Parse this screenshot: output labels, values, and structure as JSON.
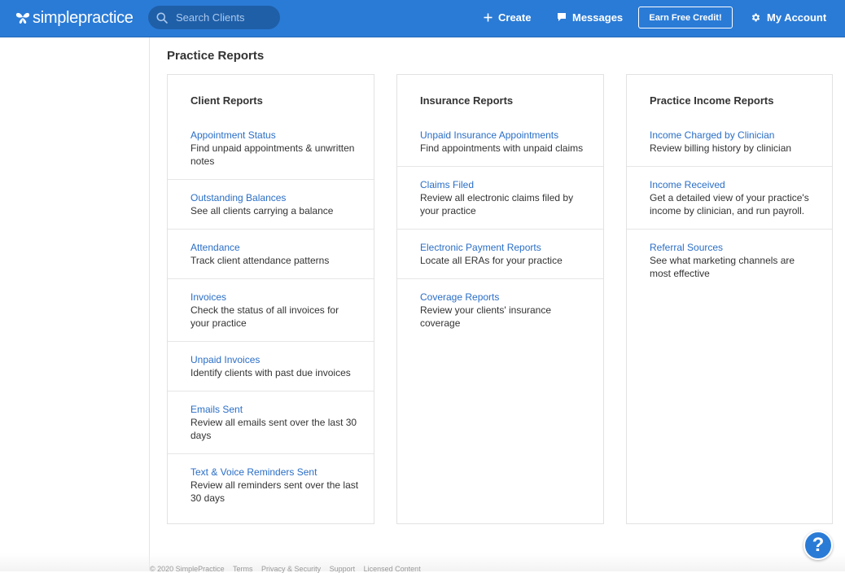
{
  "header": {
    "logo_part1": "simple",
    "logo_part2": "practice",
    "search_placeholder": "Search Clients",
    "create_label": "Create",
    "messages_label": "Messages",
    "earn_credit_label": "Earn Free Credit!",
    "account_label": "My Account",
    "brand_color": "#2a7bd6"
  },
  "page": {
    "title": "Practice Reports"
  },
  "columns": [
    {
      "title": "Client Reports",
      "reports": [
        {
          "link": "Appointment Status",
          "desc": "Find unpaid appointments & unwritten notes"
        },
        {
          "link": "Outstanding Balances",
          "desc": "See all clients carrying a balance"
        },
        {
          "link": "Attendance",
          "desc": "Track client attendance patterns"
        },
        {
          "link": "Invoices",
          "desc": "Check the status of all invoices for your practice"
        },
        {
          "link": "Unpaid Invoices",
          "desc": "Identify clients with past due invoices"
        },
        {
          "link": "Emails Sent",
          "desc": "Review all emails sent over the last 30 days"
        },
        {
          "link": "Text & Voice Reminders Sent",
          "desc": "Review all reminders sent over the last 30 days"
        }
      ]
    },
    {
      "title": "Insurance Reports",
      "reports": [
        {
          "link": "Unpaid Insurance Appointments",
          "desc": "Find appointments with unpaid claims"
        },
        {
          "link": "Claims Filed",
          "desc": "Review all electronic claims filed by your practice"
        },
        {
          "link": "Electronic Payment Reports",
          "desc": "Locate all ERAs for your practice"
        },
        {
          "link": "Coverage Reports",
          "desc": "Review your clients' insurance coverage"
        }
      ]
    },
    {
      "title": "Practice Income Reports",
      "reports": [
        {
          "link": "Income Charged by Clinician",
          "desc": "Review billing history by clinician"
        },
        {
          "link": "Income Received",
          "desc": "Get a detailed view of your practice's income by clinician, and run payroll."
        },
        {
          "link": "Referral Sources",
          "desc": "See what marketing channels are most effective"
        }
      ]
    }
  ],
  "help": {
    "label": "?"
  },
  "footer": {
    "copyright": "© 2020 SimplePractice",
    "terms": "Terms",
    "privacy": "Privacy & Security",
    "support": "Support",
    "licensed": "Licensed Content"
  },
  "icons": {
    "search": "search-icon",
    "create": "plus-icon",
    "messages": "chat-bubble-icon",
    "account": "gear-icon",
    "logo": "butterfly-logo-icon",
    "help": "question-mark-icon"
  }
}
